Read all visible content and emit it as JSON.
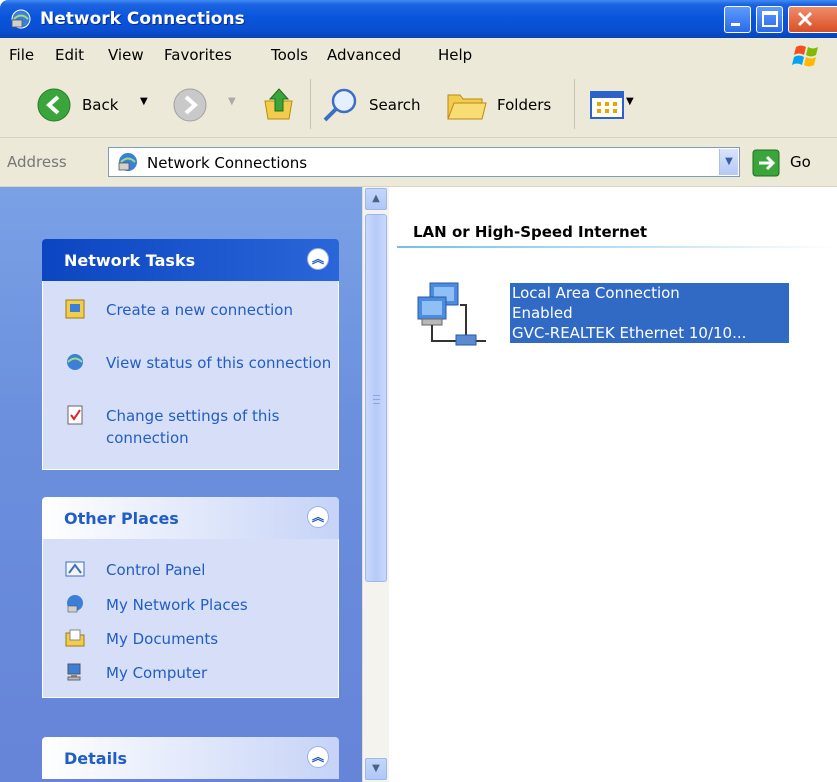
{
  "window": {
    "title": "Network Connections"
  },
  "menu": [
    "File",
    "Edit",
    "View",
    "Favorites",
    "Tools",
    "Advanced",
    "Help"
  ],
  "toolbar": {
    "back_label": "Back",
    "search_label": "Search",
    "folders_label": "Folders"
  },
  "address": {
    "label": "Address",
    "value": "Network Connections",
    "go_label": "Go"
  },
  "left_panel": {
    "network_tasks": {
      "title": "Network Tasks",
      "items": [
        {
          "label": "Create a new connection",
          "icon": "new-connection-icon"
        },
        {
          "label": "View status of this connection",
          "icon": "view-status-icon"
        },
        {
          "label": "Change settings of this connection",
          "icon": "change-settings-icon"
        }
      ]
    },
    "other_places": {
      "title": "Other Places",
      "items": [
        {
          "label": "Control Panel",
          "icon": "control-panel-icon"
        },
        {
          "label": "My Network Places",
          "icon": "network-places-icon"
        },
        {
          "label": "My Documents",
          "icon": "documents-icon"
        },
        {
          "label": "My Computer",
          "icon": "computer-icon"
        }
      ]
    },
    "details": {
      "title": "Details"
    }
  },
  "content": {
    "group_header": "LAN or High-Speed Internet",
    "connection": {
      "name": "Local Area Connection",
      "status": "Enabled",
      "device": "GVC-REALTEK Ethernet 10/10..."
    }
  },
  "colors": {
    "titlebar": "#0855dd",
    "selection": "#316ac5",
    "link": "#215dc6",
    "left_panel": "#6b8fdd"
  }
}
